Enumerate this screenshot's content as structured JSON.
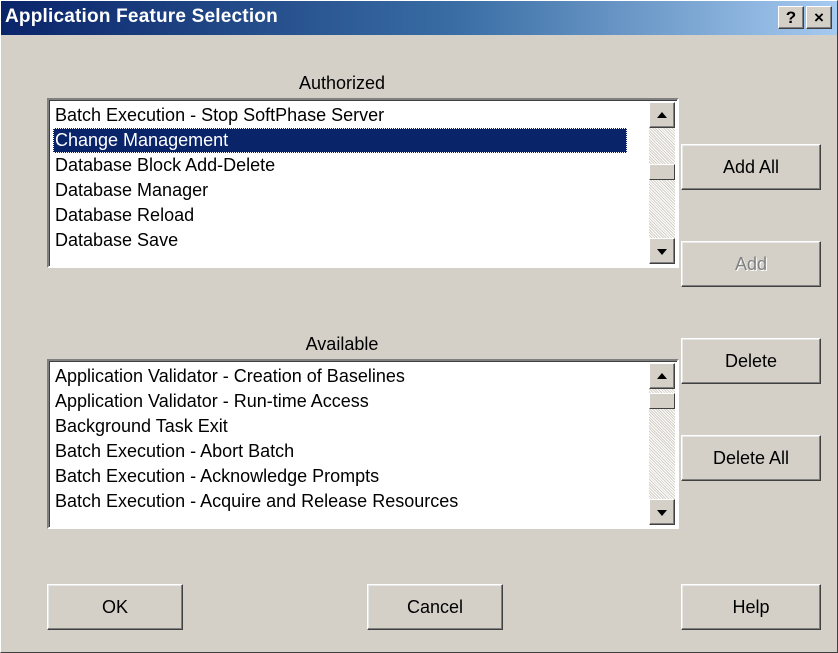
{
  "window": {
    "title": "Application Feature Selection",
    "help_glyph": "?",
    "close_glyph": "×"
  },
  "authorized": {
    "label": "Authorized",
    "items": [
      "Batch Execution - Stop SoftPhase Server",
      "Change Management",
      "Database Block Add-Delete",
      "Database Manager",
      "Database Reload",
      "Database Save"
    ],
    "selected": "Change Management"
  },
  "available": {
    "label": "Available",
    "items": [
      "Application Validator - Creation of Baselines",
      "Application Validator - Run-time Access",
      "Background Task Exit",
      "Batch Execution - Abort Batch",
      "Batch Execution - Acknowledge Prompts",
      "Batch Execution - Acquire and Release Resources"
    ]
  },
  "buttons": {
    "add_all": "Add All",
    "add": "Add",
    "delete": "Delete",
    "delete_all": "Delete All",
    "ok": "OK",
    "cancel": "Cancel",
    "help": "Help"
  },
  "colors": {
    "title_gradient_start": "#0a246a",
    "title_gradient_end": "#a6caf0",
    "selection": "#0a246a",
    "face": "#d4d0c8"
  },
  "icons": {
    "help": "help-icon",
    "close": "close-icon",
    "scroll_up": "arrow-up-icon",
    "scroll_down": "arrow-down-icon"
  }
}
